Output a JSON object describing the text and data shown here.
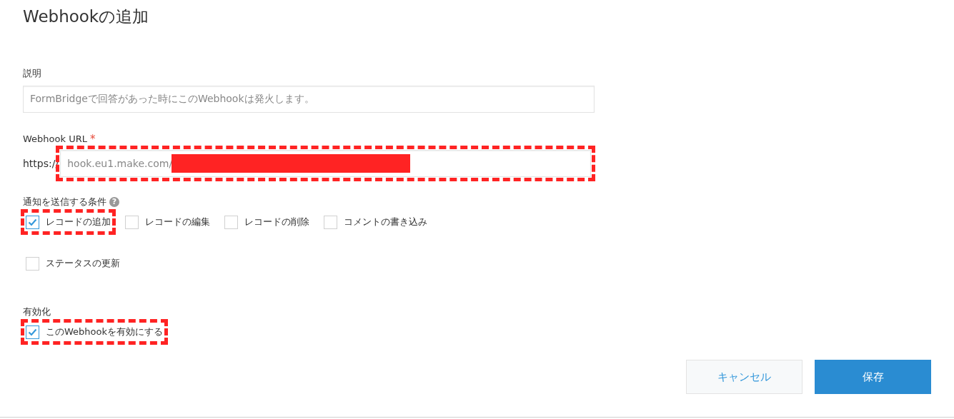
{
  "title": "Webhookの追加",
  "description": {
    "label": "説明",
    "value": "FormBridgeで回答があった時にこのWebhookは発火します。"
  },
  "url": {
    "label": "Webhook URL",
    "required_mark": "*",
    "prefix": "https://",
    "value": "hook.eu1.make.com/",
    "redacted": true,
    "highlighted": true
  },
  "conditions": {
    "label": "通知を送信する条件",
    "help": "?",
    "options": [
      {
        "label": "レコードの追加",
        "checked": true,
        "highlighted": true
      },
      {
        "label": "レコードの編集",
        "checked": false,
        "highlighted": false
      },
      {
        "label": "レコードの削除",
        "checked": false,
        "highlighted": false
      },
      {
        "label": "コメントの書き込み",
        "checked": false,
        "highlighted": false
      },
      {
        "label": "ステータスの更新",
        "checked": false,
        "highlighted": false
      }
    ]
  },
  "enable": {
    "label": "有効化",
    "options": [
      {
        "label": "このWebhookを有効にする",
        "checked": true,
        "highlighted": true
      }
    ]
  },
  "buttons": [
    {
      "label": "キャンセル",
      "kind": "secondary"
    },
    {
      "label": "保存",
      "kind": "primary"
    }
  ]
}
